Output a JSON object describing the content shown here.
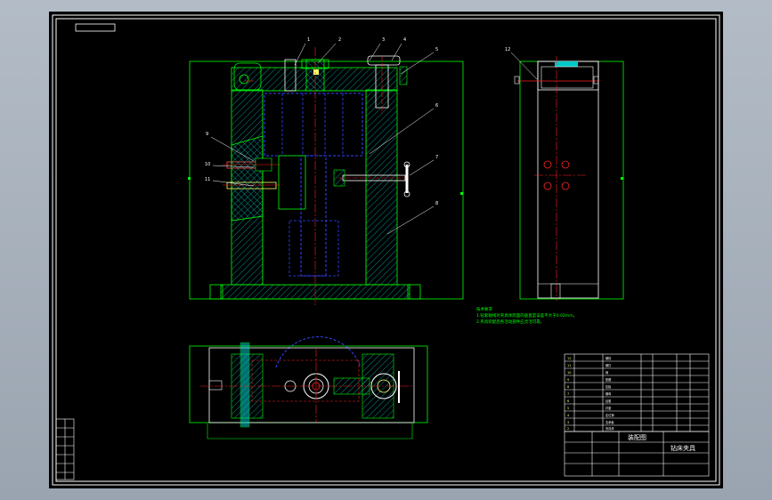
{
  "drawing": {
    "title_block": {
      "drawing_title": "钻床夹具",
      "part_label": "装配图"
    },
    "notes": {
      "heading": "技术要求",
      "line1": "1.钻套轴线对夹具体底面的垂直度误差不大于0.02mm。",
      "line2": "2.夹具装配后各活动部件应灵活可靠。"
    },
    "callouts": [
      "1",
      "2",
      "3",
      "4",
      "5",
      "6",
      "7",
      "8",
      "9",
      "10",
      "11",
      "12"
    ],
    "colors": {
      "background": "#000000",
      "border": "#ffffff",
      "hatch": "#00c8c8",
      "outline": "#00ff00",
      "centerline": "#ff2020",
      "hidden": "#3344ff",
      "yellow": "#ffff66",
      "desktop": "#a7b0bb"
    }
  }
}
